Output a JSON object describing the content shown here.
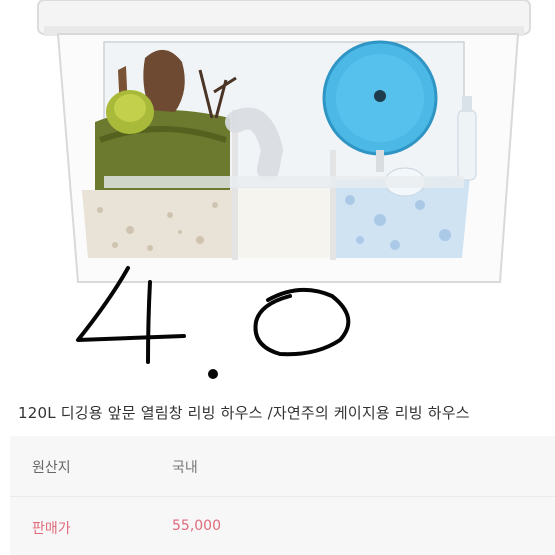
{
  "product": {
    "title": "120L 디깅용 앞문 열림창 리빙 하우스 /자연주의 케이지용 리빙 하우스",
    "photo_overlay_text": "4.0"
  },
  "info": {
    "origin_label": "원산지",
    "origin_value": "국내",
    "price_label": "판매가",
    "price_value": "55,000"
  },
  "colors": {
    "price": "#e06b7c",
    "wheel": "#4bb8e6",
    "moss": "#6b7a2e"
  }
}
